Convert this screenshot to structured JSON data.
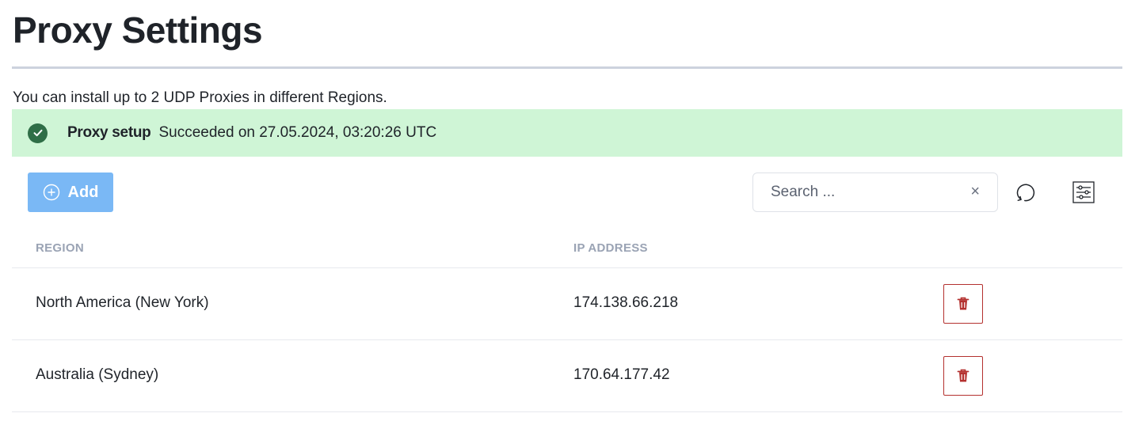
{
  "page": {
    "title": "Proxy Settings",
    "intro": "You can install up to 2 UDP Proxies in different Regions."
  },
  "status_banner": {
    "title": "Proxy setup",
    "message": "Succeeded on 27.05.2024, 03:20:26 UTC",
    "icon": "check-circle-icon",
    "color": "#cff5d6"
  },
  "toolbar": {
    "add_label": "Add",
    "search_placeholder": "Search ...",
    "clear_icon": "×"
  },
  "table": {
    "columns": [
      "REGION",
      "IP ADDRESS"
    ],
    "rows": [
      {
        "region": "North America (New York)",
        "ip": "174.138.66.218"
      },
      {
        "region": "Australia (Sydney)",
        "ip": "170.64.177.42"
      }
    ]
  },
  "colors": {
    "accent": "#7ab8f5",
    "danger": "#b4312f",
    "success": "#2f6e47"
  }
}
